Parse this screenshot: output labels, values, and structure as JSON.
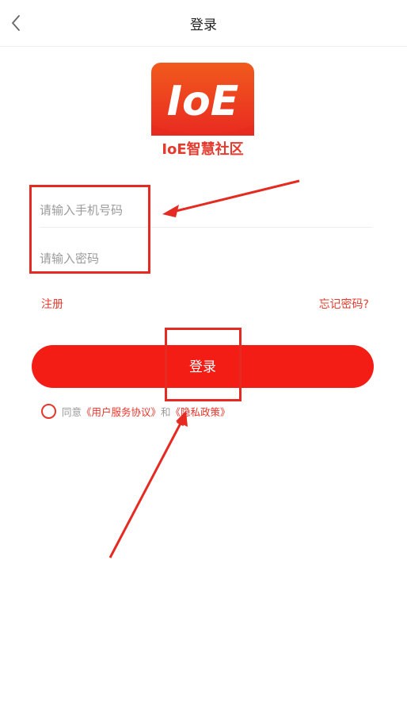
{
  "header": {
    "title": "登录",
    "back_icon": "chevron-left-icon"
  },
  "logo": {
    "big_text": "IoE",
    "caption": "IoE智慧社区",
    "gradient_top": "#f15a1d",
    "gradient_bottom": "#e92a21"
  },
  "form": {
    "phone_placeholder": "请输入手机号码",
    "phone_value": "",
    "password_placeholder": "请输入密码",
    "password_value": ""
  },
  "links": {
    "register": "注册",
    "forgot": "忘记密码?"
  },
  "login_button": {
    "label": "登录",
    "color": "#f31d16"
  },
  "agreement": {
    "agree_text": "同意",
    "user_agreement": "《用户服务协议》",
    "and_text": "和",
    "privacy_policy": "《隐私政策》",
    "checked": false
  },
  "colors": {
    "accent": "#e8342a",
    "annotation": "#e52a21"
  }
}
